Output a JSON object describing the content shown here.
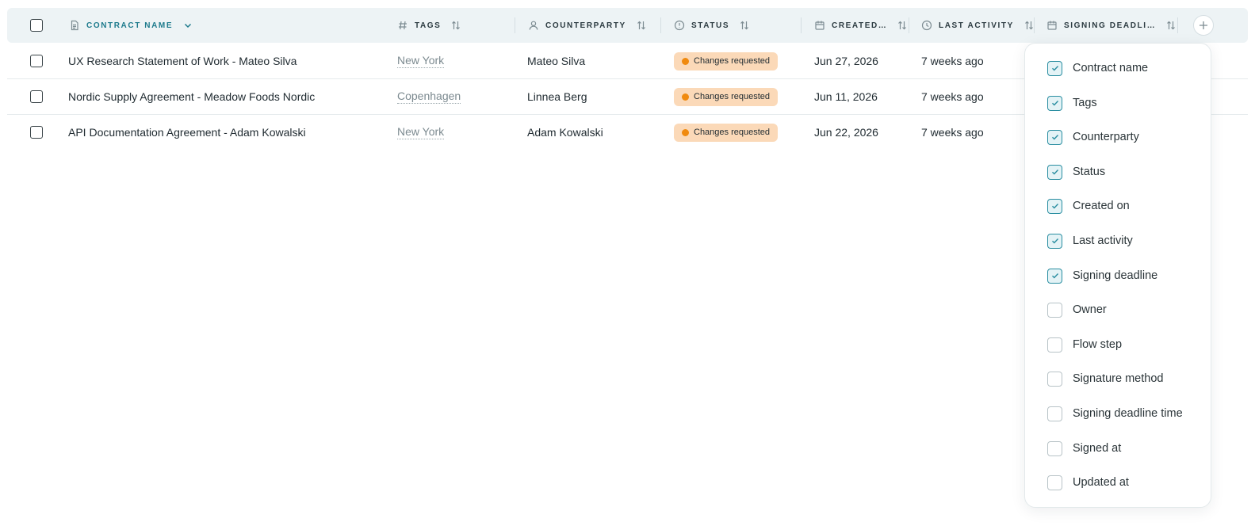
{
  "header": {
    "columns": [
      {
        "key": "contract_name",
        "label": "Contract name",
        "icon": "document-icon",
        "sort": "chevron-down-icon"
      },
      {
        "key": "tags",
        "label": "Tags",
        "icon": "hash-icon",
        "sort": "sort-arrows-icon"
      },
      {
        "key": "counterparty",
        "label": "Counterparty",
        "icon": "user-icon",
        "sort": "sort-arrows-icon"
      },
      {
        "key": "status",
        "label": "Status",
        "icon": "alert-circle-icon",
        "sort": "sort-arrows-icon"
      },
      {
        "key": "created",
        "label": "Created…",
        "icon": "calendar-icon",
        "sort": "sort-arrows-icon"
      },
      {
        "key": "last_activity",
        "label": "Last activity",
        "icon": "clock-icon",
        "sort": "sort-arrows-icon"
      },
      {
        "key": "signing_deadline",
        "label": "Signing deadli…",
        "icon": "calendar-icon",
        "sort": "sort-arrows-icon"
      }
    ],
    "add_column_icon": "plus-icon"
  },
  "rows": [
    {
      "name": "UX Research Statement of Work - Mateo Silva",
      "tag": "New York",
      "counterparty": "Mateo Silva",
      "status": "Changes requested",
      "created": "Jun 27, 2026",
      "last_activity": "7 weeks ago"
    },
    {
      "name": "Nordic Supply Agreement - Meadow Foods Nordic",
      "tag": "Copenhagen",
      "counterparty": "Linnea Berg",
      "status": "Changes requested",
      "created": "Jun 11, 2026",
      "last_activity": "7 weeks ago"
    },
    {
      "name": "API Documentation Agreement - Adam Kowalski",
      "tag": "New York",
      "counterparty": "Adam Kowalski",
      "status": "Changes requested",
      "created": "Jun 22, 2026",
      "last_activity": "7 weeks ago"
    }
  ],
  "column_menu": {
    "options": [
      {
        "label": "Contract name",
        "checked": true
      },
      {
        "label": "Tags",
        "checked": true
      },
      {
        "label": "Counterparty",
        "checked": true
      },
      {
        "label": "Status",
        "checked": true
      },
      {
        "label": "Created on",
        "checked": true
      },
      {
        "label": "Last activity",
        "checked": true
      },
      {
        "label": "Signing deadline",
        "checked": true
      },
      {
        "label": "Owner",
        "checked": false
      },
      {
        "label": "Flow step",
        "checked": false
      },
      {
        "label": "Signature method",
        "checked": false
      },
      {
        "label": "Signing deadline time",
        "checked": false
      },
      {
        "label": "Signed at",
        "checked": false
      },
      {
        "label": "Updated at",
        "checked": false
      }
    ]
  },
  "colors": {
    "accent": "#1d7a8c",
    "status_bg": "#fbd9b8",
    "status_dot": "#f08a0f",
    "header_bg": "#edf3f5"
  }
}
